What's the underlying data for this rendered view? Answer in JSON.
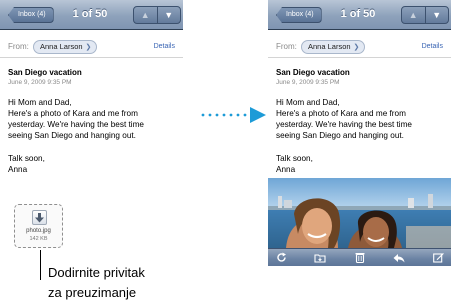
{
  "left_phone": {
    "navbar": {
      "back_label": "Inbox (4)",
      "count": "1 of 50"
    },
    "from_label": "From:",
    "sender": "Anna Larson",
    "details_label": "Details",
    "subject": "San Diego vacation",
    "date": "June 9, 2009 9:35 PM",
    "body_lines": [
      "Hi Mom and Dad,",
      "Here's a photo of Kara and me from",
      "yesterday. We're having the best time",
      "seeing San Diego and hanging out."
    ],
    "sign_lines": [
      "Talk soon,",
      "Anna"
    ],
    "attachment": {
      "name": "photo.jpg",
      "size": "142 KB",
      "icon": "download-icon"
    }
  },
  "right_phone": {
    "navbar": {
      "back_label": "Inbox (4)",
      "count": "1 of 50"
    },
    "from_label": "From:",
    "sender": "Anna Larson",
    "details_label": "Details",
    "subject": "San Diego vacation",
    "date": "June 9, 2009 9:35 PM",
    "body_lines": [
      "Hi Mom and Dad,",
      "Here's a photo of Kara and me from",
      "yesterday. We're having the best time",
      "seeing San Diego and hanging out."
    ],
    "sign_lines": [
      "Talk soon,",
      "Anna"
    ],
    "toolbar_icons": [
      "refresh-icon",
      "folder-icon",
      "trash-icon",
      "reply-icon",
      "compose-icon"
    ]
  },
  "callout": {
    "line1": "Dodirnite privitak",
    "line2": "za preuzimanje"
  },
  "colors": {
    "navbar": "#8ea2bb",
    "link": "#3a65b4",
    "toolbar": "#6a82a3",
    "arrow": "#1d9bd7"
  }
}
